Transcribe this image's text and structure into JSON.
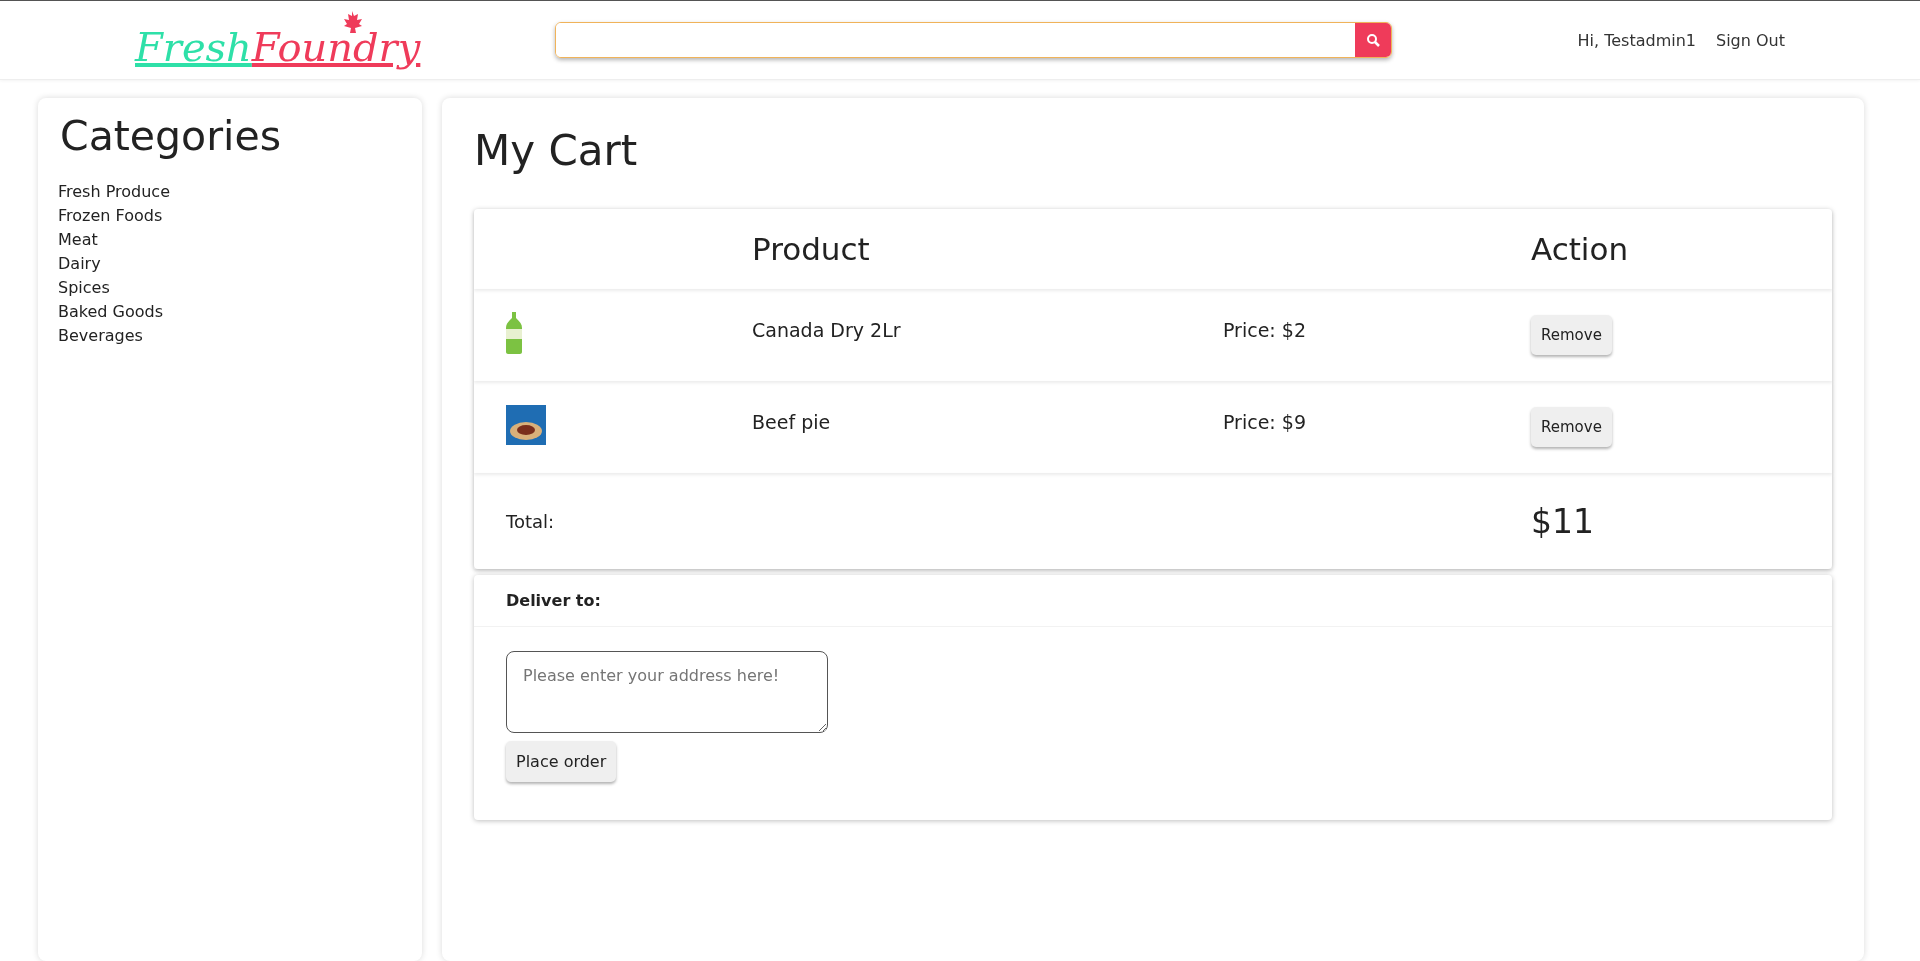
{
  "header": {
    "logo": {
      "first": "Fresh",
      "second": "Foundry"
    },
    "greeting": "Hi, Testadmin1",
    "sign_out": "Sign Out"
  },
  "sidebar": {
    "title": "Categories",
    "items": [
      "Fresh Produce",
      "Frozen Foods",
      "Meat",
      "Dairy",
      "Spices",
      "Baked Goods",
      "Beverages"
    ]
  },
  "cart": {
    "title": "My Cart",
    "columns": [
      "Product",
      "Action"
    ],
    "rows": [
      {
        "kind": "bottle",
        "product": "Canada Dry 2Lr",
        "price": "Price: $2",
        "action": "Remove"
      },
      {
        "kind": "pie",
        "product": "Beef pie",
        "price": "Price: $9",
        "action": "Remove"
      }
    ],
    "total_label": "Total:",
    "total": "$11"
  },
  "delivery": {
    "label": "Deliver to:",
    "placeholder": "Please enter your address here!",
    "button": "Place order"
  }
}
